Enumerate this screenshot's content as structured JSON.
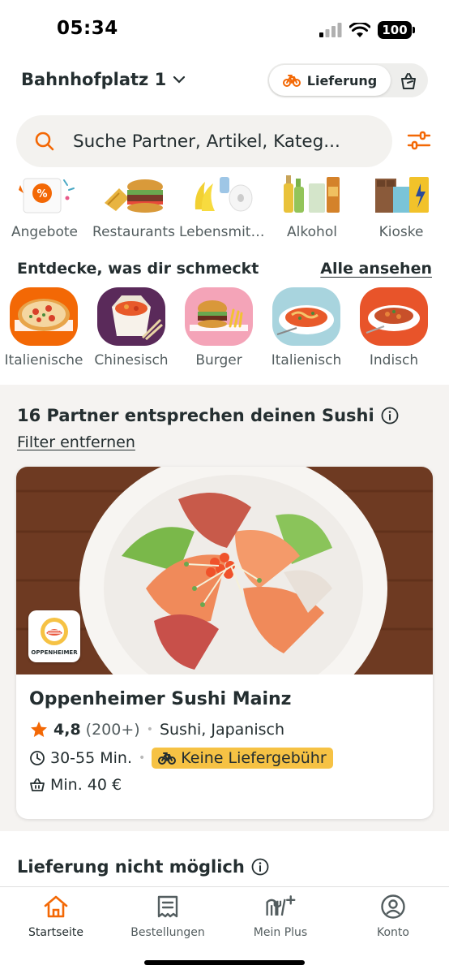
{
  "status_bar": {
    "time": "05:34",
    "battery": "100"
  },
  "header": {
    "address": "Bahnhofplatz 1",
    "delivery_label": "Lieferung"
  },
  "search": {
    "placeholder": "Suche Partner, Artikel, Kateg..."
  },
  "categories": [
    {
      "label": "Angebote"
    },
    {
      "label": "Restaurants"
    },
    {
      "label": "Lebensmittel"
    },
    {
      "label": "Alkohol"
    },
    {
      "label": "Kioske"
    }
  ],
  "discover": {
    "title": "Entdecke, was dir schmeckt",
    "see_all": "Alle ansehen",
    "cuisines": [
      {
        "label": "Italienische"
      },
      {
        "label": "Chinesisch"
      },
      {
        "label": "Burger"
      },
      {
        "label": "Italienisch"
      },
      {
        "label": "Indisch"
      }
    ]
  },
  "partners": {
    "title": "16 Partner entsprechen deinen Sushi",
    "remove_filter": "Filter entfernen"
  },
  "restaurant": {
    "logo_text": "OPPENHEIMER",
    "name": "Oppenheimer Sushi Mainz",
    "rating": "4,8",
    "reviews": "(200+)",
    "cuisines": "Sushi, Japanisch",
    "delivery_time": "30-55 Min.",
    "delivery_fee": "Keine Liefergebühr",
    "min_order": "Min. 40 €"
  },
  "unavailable": {
    "title": "Lieferung nicht möglich"
  },
  "nav": {
    "home": "Startseite",
    "orders": "Bestellungen",
    "plus": "Mein Plus",
    "account": "Konto"
  },
  "colors": {
    "accent": "#f36805",
    "badge": "#f6c244",
    "text": "#242e30",
    "muted": "#535d5f"
  }
}
